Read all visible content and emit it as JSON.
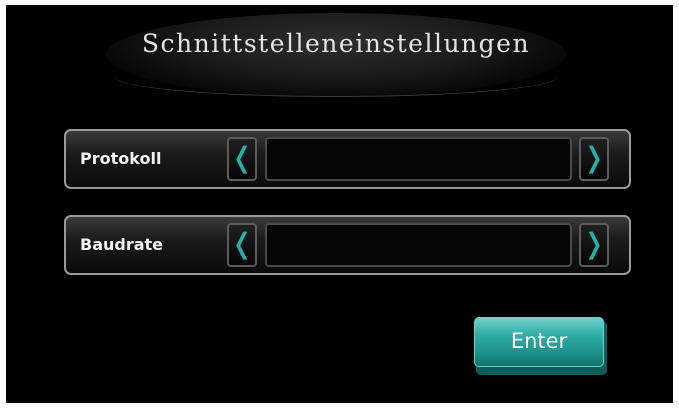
{
  "title": "Schnittstelleneinstellungen",
  "rows": [
    {
      "label": "Protokoll",
      "value": "",
      "prev_glyph": "❬",
      "next_glyph": "❭"
    },
    {
      "label": "Baudrate",
      "value": "",
      "prev_glyph": "❬",
      "next_glyph": "❭"
    }
  ],
  "enter_button": {
    "label": "Enter"
  },
  "colors": {
    "background": "#000000",
    "accent": "#1fb3ad",
    "button": "#30ada6",
    "text": "#e4e4e4"
  },
  "icons": [
    "chevron-left-icon",
    "chevron-right-icon"
  ]
}
